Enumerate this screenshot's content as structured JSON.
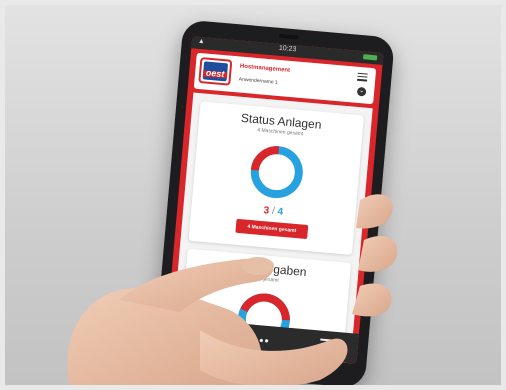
{
  "status_bar": {
    "time": "10:23"
  },
  "app": {
    "logo_text": "oest",
    "header_title": "Hostmanagement",
    "header_user": "Anwendername 1",
    "colors": {
      "brand_red": "#d8262a",
      "accent_blue": "#27a1e0",
      "logo_blue": "#1d4f9c"
    }
  },
  "card_anlagen": {
    "title": "Status Anlagen",
    "subtitle": "4 Maschinen gesamt",
    "active": "3",
    "separator": "/",
    "total": "4",
    "button_label": "4 Maschinen gesamt",
    "donut_fraction_red": 0.25
  },
  "card_aufgaben": {
    "title": "St… aufgaben",
    "subtitle": "… gesamt"
  },
  "nav": {
    "back_icon": "chevron-left-icon",
    "more_icon": "more-dots-icon",
    "list_icon": "list-icon"
  }
}
